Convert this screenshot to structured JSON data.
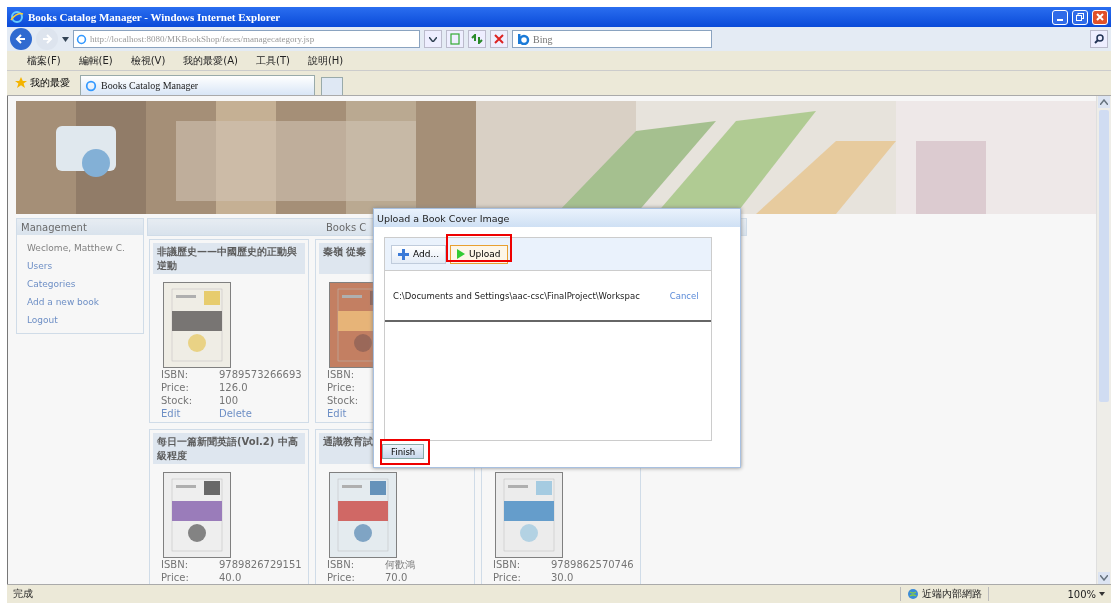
{
  "window": {
    "title": "Books Catalog Manager - Windows Internet Explorer"
  },
  "address_bar": {
    "value": "http://localhost:8080/MKBookShop/faces/managecategory.jsp"
  },
  "search": {
    "placeholder": "Bing"
  },
  "menu": [
    "檔案(F)",
    "編輯(E)",
    "檢視(V)",
    "我的最愛(A)",
    "工具(T)",
    "說明(H)"
  ],
  "favorites": {
    "label": "我的最愛"
  },
  "tabs": [
    {
      "label": "Books Catalog Manager",
      "selected": true
    }
  ],
  "sidebar": {
    "title": "Management",
    "items": [
      {
        "label": "Weclome, Matthew C.",
        "kind": "text"
      },
      {
        "label": "Users",
        "kind": "link"
      },
      {
        "label": "Categories",
        "kind": "link"
      },
      {
        "label": "Add a new book",
        "kind": "link"
      },
      {
        "label": "Logout",
        "kind": "link"
      }
    ]
  },
  "books_header": {
    "title": "Books C"
  },
  "book_rows": [
    [
      {
        "title": "非議歷史——中國歷史的正動與逆動",
        "fields": [
          {
            "label": "ISBN:",
            "value": "9789573266693"
          },
          {
            "label": "Price:",
            "value": "126.0"
          },
          {
            "label": "Stock:",
            "value": "100"
          }
        ],
        "links": [
          "Edit",
          "Delete"
        ]
      },
      {
        "title": "秦嶺 從秦",
        "fields": [
          {
            "label": "ISBN:"
          },
          {
            "label": "Price:"
          },
          {
            "label": "Stock:"
          }
        ],
        "links": [
          "Edit"
        ]
      }
    ],
    [
      {
        "title": "每日一篇新聞英語(Vol.2) 中高級程度",
        "fields": [
          {
            "label": "ISBN:",
            "value": "9789826729151"
          },
          {
            "label": "Price:",
            "value": "40.0"
          }
        ]
      },
      {
        "title": "通識教育試",
        "fields": [
          {
            "label": "ISBN:",
            "value": "何歡鴻"
          },
          {
            "label": "Price:",
            "value": "70.0"
          }
        ]
      },
      {
        "fields": [
          {
            "label": "ISBN:",
            "value": "9789862570746"
          },
          {
            "label": "Price:",
            "value": "30.0"
          }
        ]
      }
    ]
  ],
  "dialog": {
    "title": "Upload a Book Cover Image",
    "toolbar": [
      {
        "label": "Add...",
        "kind": "add",
        "focused": false,
        "highlighted": false
      },
      {
        "label": "Upload",
        "kind": "upload",
        "focused": true,
        "highlighted": true
      }
    ],
    "files": [
      {
        "path": "C:\\Documents and Settings\\aac-csc\\FinalProject\\Workspac",
        "action": "Cancel"
      }
    ],
    "finish": {
      "label": "Finish",
      "highlighted": true
    }
  },
  "status_bar": {
    "text": "完成",
    "zone": "近端內部網路",
    "zoom": "100%"
  }
}
